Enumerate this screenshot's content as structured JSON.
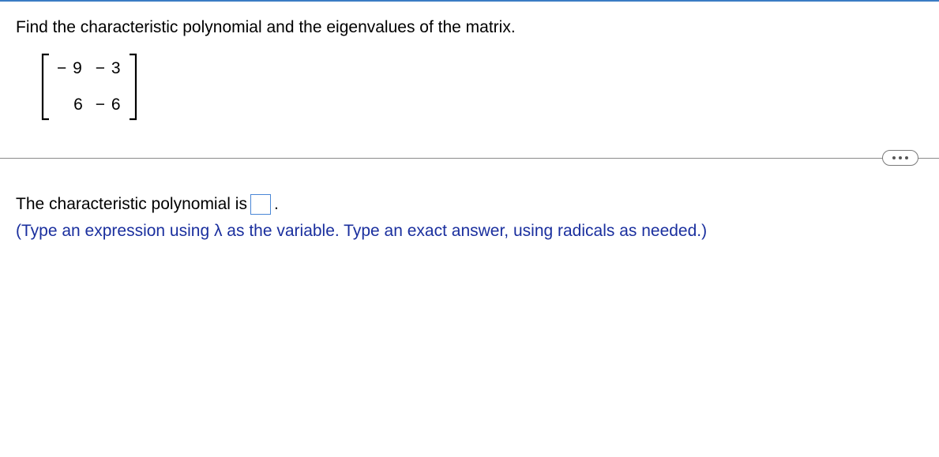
{
  "question": {
    "prompt": "Find the characteristic polynomial and the eigenvalues of the matrix.",
    "matrix": {
      "r0c0": "− 9",
      "r0c1": "− 3",
      "r1c0": "6",
      "r1c1": "− 6"
    }
  },
  "answer": {
    "lead": "The characteristic polynomial is",
    "period": ".",
    "instruction": "(Type an expression using λ as the variable. Type an exact answer, using radicals as needed.)"
  }
}
